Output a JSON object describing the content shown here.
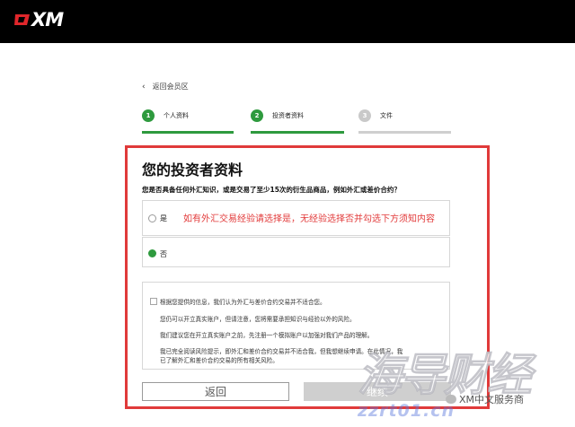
{
  "brand": {
    "name": "XM",
    "accent": "#e0262b"
  },
  "nav": {
    "back_label": "返回会员区",
    "back_icon": "chevron-left-icon"
  },
  "steps": [
    {
      "number": "1",
      "label": "个人资料",
      "state": "done",
      "progress": 1.0
    },
    {
      "number": "2",
      "label": "投资者资料",
      "state": "current",
      "progress": 1.0
    },
    {
      "number": "3",
      "label": "文件",
      "state": "todo",
      "progress": 0.0
    }
  ],
  "form": {
    "title": "您的投资者资料",
    "question": "您是否具备任何外汇知识，或是交易了至少15次的衍生品商品，例如外汇或差价合约？",
    "options": [
      {
        "label": "是",
        "selected": false
      },
      {
        "label": "否",
        "selected": true
      }
    ],
    "annotation": "如有外汇交易经验请选择是，无经验选择否并勾选下方须知内容",
    "disclaimer": {
      "checked": false,
      "lines": [
        "根据您提供的信息，我们认为外汇与差价合约交易并不适合您。",
        "您仍可以开立真实账户，但请注意，您将需要承担知识与经验以外的风险。",
        "我们建议您在开立真实账户之前，先注册一个模拟账户以加强对我们产品的理解。",
        "我已完全阅读风险提示，即外汇和差价合约交易并不适合我，但我想继续申请。在此情况，我",
        "已了解外汇和差价合约交易的所有相关风险。"
      ]
    },
    "back_button": "返回",
    "next_button": "继续"
  },
  "watermark": {
    "big_text": "海导财经",
    "url": "zzrt01.cn",
    "caption": "XM中文服务商"
  },
  "colors": {
    "green": "#2e9a3e",
    "highlight_frame": "#e03a3a",
    "annotation": "#e23b3b"
  }
}
